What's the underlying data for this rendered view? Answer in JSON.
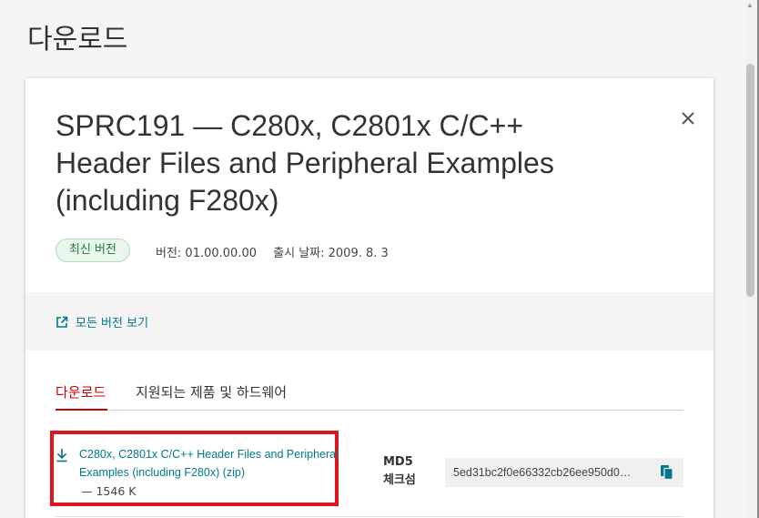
{
  "page": {
    "title": "다운로드"
  },
  "modal": {
    "title": "SPRC191 — C280x, C2801x C/C++ Header Files and Peripheral Examples (including F280x)",
    "badge": "최신 버전",
    "version": "버전: 01.00.00.00",
    "release_date": "출시 날짜: 2009. 8. 3",
    "all_versions_link": "모든 버전 보기",
    "tabs": [
      {
        "label": "다운로드",
        "active": true
      },
      {
        "label": "지원되는 제품 및 하드웨어",
        "active": false
      }
    ],
    "download": {
      "link_text": "C280x, C2801x C/C++ Header Files and Peripheral Examples (including F280x) (zip)",
      "size": "— 1546 K"
    },
    "md5": {
      "label": "MD5 체크섬",
      "value": "5ed31bc2f0e66332cb26ee950d0…"
    }
  },
  "colors": {
    "accent_link": "#00788f",
    "active_tab": "#cc0000",
    "badge_bg": "#e9f6ec",
    "badge_text": "#1f7a3a",
    "highlight": "#e0161f"
  },
  "icons": {
    "close": "close-icon",
    "external": "external-link-icon",
    "download": "download-icon",
    "copy": "copy-icon"
  }
}
